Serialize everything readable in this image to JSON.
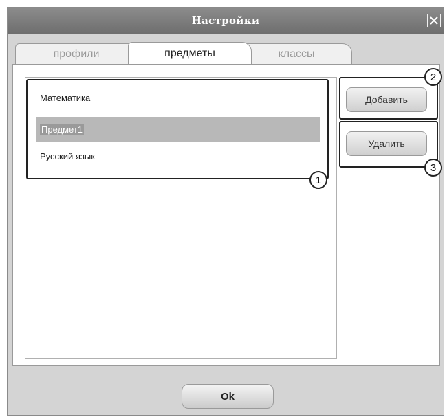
{
  "window": {
    "title": "Настройки",
    "close_icon": "close-icon"
  },
  "tabs": [
    {
      "label": "профили",
      "active": false
    },
    {
      "label": "предметы",
      "active": true
    },
    {
      "label": "классы",
      "active": false
    }
  ],
  "subjects": {
    "items": [
      {
        "label": "Математика",
        "selected": false
      },
      {
        "label": "Предмет1",
        "selected": true
      },
      {
        "label": "Русский язык",
        "selected": false
      }
    ]
  },
  "buttons": {
    "add": "Добавить",
    "delete": "Удалить",
    "ok": "Ok"
  },
  "callouts": {
    "list": "1",
    "add": "2",
    "delete": "3"
  },
  "colors": {
    "titlebar": "#7a7a7a",
    "selection": "#b8b8b8",
    "window_bg": "#d4d4d4"
  }
}
